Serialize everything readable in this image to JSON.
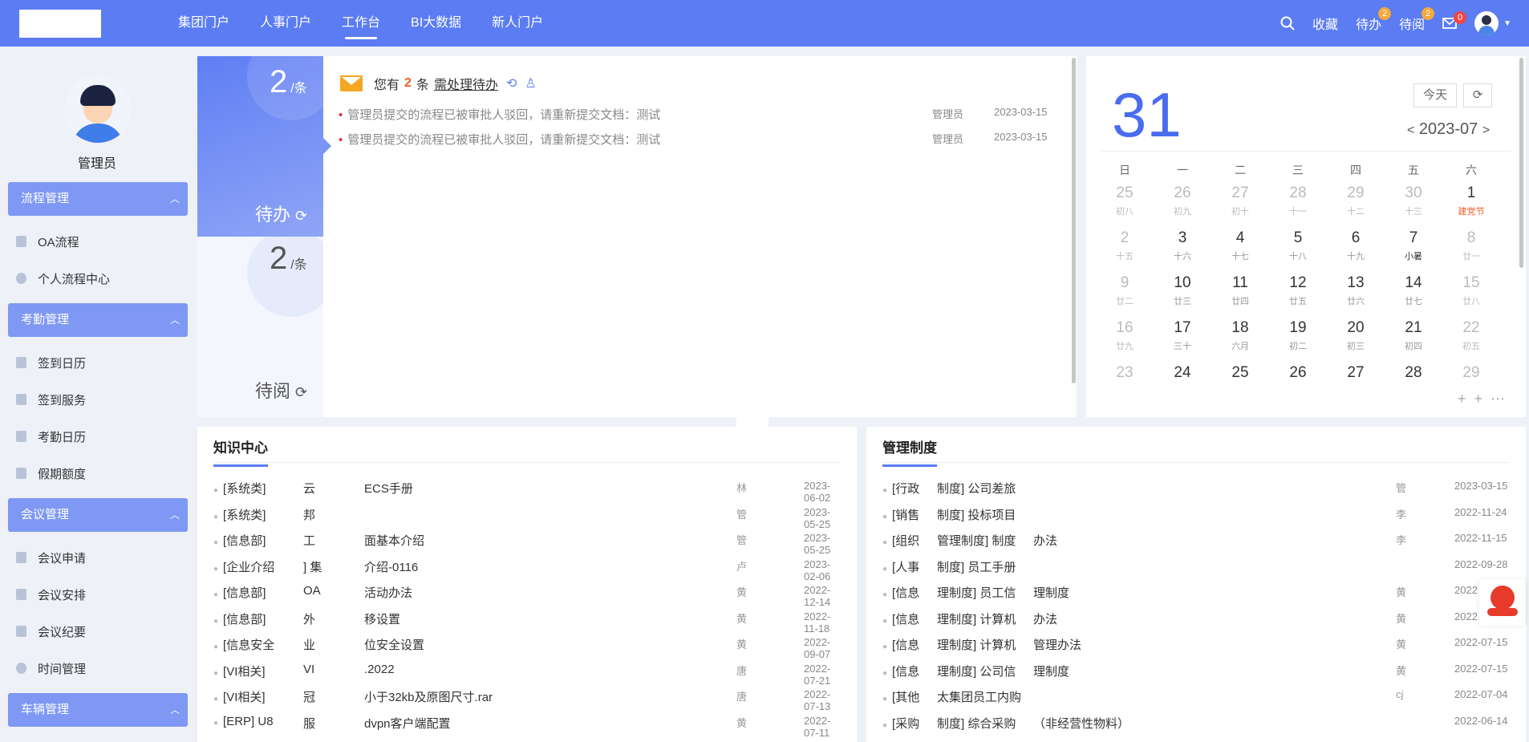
{
  "nav": {
    "items": [
      {
        "label": "集团门户"
      },
      {
        "label": "人事门户"
      },
      {
        "label": "工作台",
        "active": true
      },
      {
        "label": "BI大数据"
      },
      {
        "label": "新人门户"
      }
    ]
  },
  "topright": {
    "favorites": "收藏",
    "todo": "待办",
    "todo_badge": "2",
    "toread": "待阅",
    "toread_badge": "2",
    "mail_badge": "0"
  },
  "profile": {
    "name": "管理员"
  },
  "sidebar": {
    "s1": "流程管理",
    "s1_items": [
      "OA流程",
      "个人流程中心"
    ],
    "s2": "考勤管理",
    "s2_items": [
      "签到日历",
      "签到服务",
      "考勤日历",
      "假期额度"
    ],
    "s3": "会议管理",
    "s3_items": [
      "会议申请",
      "会议安排",
      "会议纪要",
      "时间管理"
    ],
    "s4": "车辆管理"
  },
  "stats": {
    "todo_num": "2",
    "todo_unit": "/条",
    "todo_label": "待办",
    "read_num": "2",
    "read_unit": "/条",
    "read_label": "待阅"
  },
  "todo": {
    "prefix": "您有",
    "count": "2",
    "suffix": "条",
    "link": "需处理待办",
    "rows": [
      {
        "text": "管理员提交的流程已被审批人驳回，请重新提交文档：测试",
        "user": "管理员",
        "date": "2023-03-15"
      },
      {
        "text": "管理员提交的流程已被审批人驳回，请重新提交文档：测试",
        "user": "管理员",
        "date": "2023-03-15"
      }
    ]
  },
  "calendar": {
    "day": "31",
    "today": "今天",
    "month": "2023-07",
    "weekdays": [
      "日",
      "一",
      "二",
      "三",
      "四",
      "五",
      "六"
    ],
    "rows": [
      [
        {
          "n": "25",
          "l": "初八",
          "dim": true
        },
        {
          "n": "26",
          "l": "初九",
          "dim": true
        },
        {
          "n": "27",
          "l": "初十",
          "dim": true
        },
        {
          "n": "28",
          "l": "十一",
          "dim": true
        },
        {
          "n": "29",
          "l": "十二",
          "dim": true
        },
        {
          "n": "30",
          "l": "十三",
          "dim": true
        },
        {
          "n": "1",
          "l": "建党节",
          "red": true
        }
      ],
      [
        {
          "n": "2",
          "l": "十五",
          "dim": true
        },
        {
          "n": "3",
          "l": "十六"
        },
        {
          "n": "4",
          "l": "十七"
        },
        {
          "n": "5",
          "l": "十八"
        },
        {
          "n": "6",
          "l": "十九"
        },
        {
          "n": "7",
          "l": "小暑",
          "dark": true
        },
        {
          "n": "8",
          "l": "廿一",
          "dim": true
        }
      ],
      [
        {
          "n": "9",
          "l": "廿二",
          "dim": true
        },
        {
          "n": "10",
          "l": "廿三"
        },
        {
          "n": "11",
          "l": "廿四"
        },
        {
          "n": "12",
          "l": "廿五"
        },
        {
          "n": "13",
          "l": "廿六"
        },
        {
          "n": "14",
          "l": "廿七"
        },
        {
          "n": "15",
          "l": "廿八",
          "dim": true
        }
      ],
      [
        {
          "n": "16",
          "l": "廿九",
          "dim": true
        },
        {
          "n": "17",
          "l": "三十"
        },
        {
          "n": "18",
          "l": "六月"
        },
        {
          "n": "19",
          "l": "初二"
        },
        {
          "n": "20",
          "l": "初三"
        },
        {
          "n": "21",
          "l": "初四"
        },
        {
          "n": "22",
          "l": "初五",
          "dim": true
        }
      ],
      [
        {
          "n": "23",
          "l": "",
          "dim": true
        },
        {
          "n": "24",
          "l": ""
        },
        {
          "n": "25",
          "l": ""
        },
        {
          "n": "26",
          "l": ""
        },
        {
          "n": "27",
          "l": ""
        },
        {
          "n": "28",
          "l": ""
        },
        {
          "n": "29",
          "l": "",
          "dim": true
        }
      ]
    ]
  },
  "knowledge": {
    "title": "知识中心",
    "rows": [
      {
        "a": "[系统类]",
        "b": "云",
        "c": "ECS手册",
        "u": "林",
        "d": "2023-06-02"
      },
      {
        "a": "[系统类]",
        "b": "邦",
        "c": "",
        "u": "管",
        "d": "2023-05-25"
      },
      {
        "a": "[信息部]",
        "b": "工",
        "c": "面基本介绍",
        "u": "管",
        "d": "2023-05-25"
      },
      {
        "a": "[企业介绍",
        "b": "] 集",
        "c": "介绍-0116",
        "u": "卢",
        "d": "2023-02-06"
      },
      {
        "a": "[信息部]",
        "b": "OA",
        "c": "活动办法",
        "u": "黄",
        "d": "2022-12-14"
      },
      {
        "a": "[信息部]",
        "b": "外",
        "c": "移设置",
        "u": "黄",
        "d": "2022-11-18"
      },
      {
        "a": "[信息安全",
        "b": "业",
        "c": "位安全设置",
        "u": "黄",
        "d": "2022-09-07"
      },
      {
        "a": "[VI相关]",
        "b": "VI",
        "c": ".2022",
        "u": "唐",
        "d": "2022-07-21"
      },
      {
        "a": "[VI相关]",
        "b": "冠",
        "c": "小于32kb及原图尺寸.rar",
        "u": "唐",
        "d": "2022-07-13"
      },
      {
        "a": "[ERP] U8",
        "b": "服",
        "c": "dvpn客户端配置",
        "u": "黄",
        "d": "2022-07-11"
      }
    ]
  },
  "management": {
    "title": "管理制度",
    "rows": [
      {
        "a": "[行政",
        "b": "制度] 公司差旅",
        "c": "",
        "u": "管",
        "d": "2023-03-15"
      },
      {
        "a": "[销售",
        "b": "制度] 投标项目",
        "c": "",
        "u": "李",
        "d": "2022-11-24"
      },
      {
        "a": "[组织",
        "b": "管理制度] 制度",
        "c": "办法",
        "u": "李",
        "d": "2022-11-15"
      },
      {
        "a": "[人事",
        "b": "制度] 员工手册",
        "c": "",
        "u": "",
        "d": "2022-09-28"
      },
      {
        "a": "[信息",
        "b": "理制度] 员工信",
        "c": "理制度",
        "u": "黄",
        "d": "2022"
      },
      {
        "a": "[信息",
        "b": "理制度] 计算机",
        "c": "办法",
        "u": "黄",
        "d": "2022"
      },
      {
        "a": "[信息",
        "b": "理制度] 计算机",
        "c": "管理办法",
        "u": "黄",
        "d": "2022-07-15"
      },
      {
        "a": "[信息",
        "b": "理制度] 公司信",
        "c": "理制度",
        "u": "黄",
        "d": "2022-07-15"
      },
      {
        "a": "[其他",
        "b": "太集团员工内购",
        "c": "",
        "u": "cj",
        "d": "2022-07-04"
      },
      {
        "a": "[采购",
        "b": "制度] 综合采购",
        "c": "（非经营性物料）",
        "u": "",
        "d": "2022-06-14"
      }
    ]
  }
}
